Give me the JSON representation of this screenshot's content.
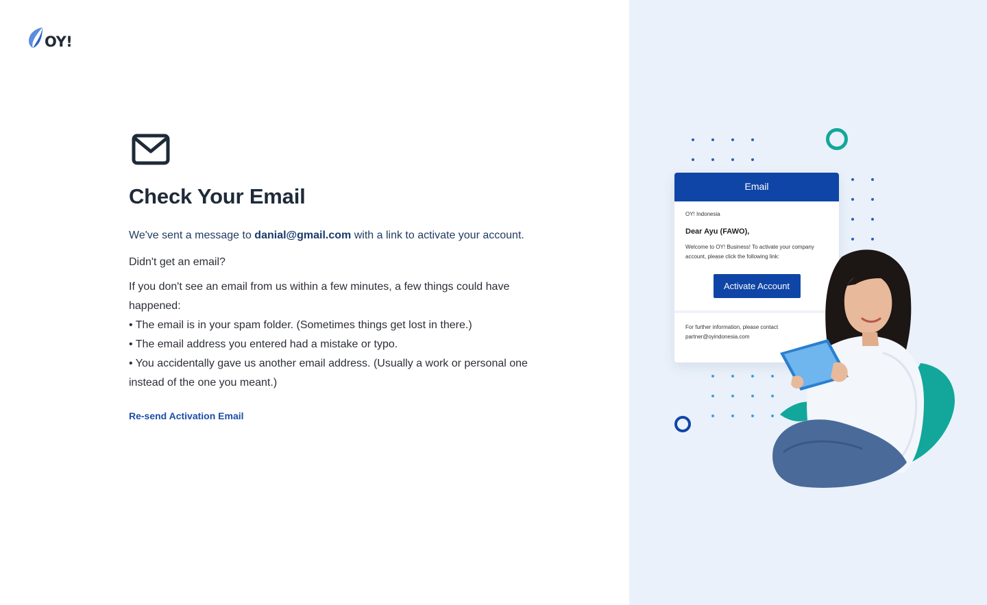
{
  "brand": {
    "logo_text": "OY!"
  },
  "main": {
    "title": "Check Your Email",
    "lead_prefix": "We've sent a message to ",
    "email": "danial@gmail.com",
    "lead_suffix": " with a link to activate your account.",
    "question": "Didn't get an email?",
    "explain": "If you don't see an email from us within a few minutes, a few things could have happened:",
    "bullets": [
      "The email is in your spam folder. (Sometimes things get lost in there.)",
      "The email address you entered had a mistake or typo.",
      "You accidentally gave us another email address. (Usually a work or personal one instead of the one you meant.)"
    ],
    "resend_label": "Re-send Activation Email"
  },
  "illustration": {
    "card_header": "Email",
    "from": "OY! Indonesia",
    "greeting": "Dear Ayu (FAWO),",
    "message": "Welcome to OY! Business! To activate your company account, please click the following link:",
    "button_label": "Activate Account",
    "footer": "For further information, please contact partner@oyindonesia.com"
  },
  "colors": {
    "primary": "#0f45a6",
    "link": "#1b4ea8",
    "teal": "#12a79a",
    "panel_bg": "#eaf1fa"
  }
}
